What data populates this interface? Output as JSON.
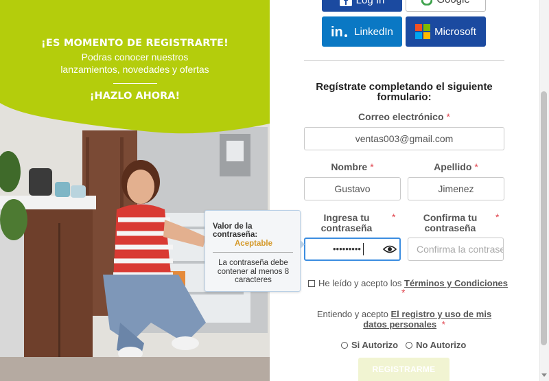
{
  "hero": {
    "headline": "¡ES MOMENTO DE REGISTRARTE!",
    "subtitle_line1": "Podras conocer nuestros",
    "subtitle_line2": "lanzamientos, novedades y ofertas",
    "cta": "¡HAZLO AHORA!"
  },
  "social": {
    "top_left_label": "Log In",
    "top_right_label": "Google",
    "linkedin_label": "LinkedIn",
    "microsoft_label": "Microsoft"
  },
  "form": {
    "title": "Regístrate completando el siguiente formulario:",
    "email_label": "Correo electrónico",
    "email_value": "ventas003@gmail.com",
    "name_label": "Nombre",
    "name_value": "Gustavo",
    "lastname_label": "Apellido",
    "lastname_value": "Jimenez",
    "password_label_line1": "Ingresa tu",
    "password_label_line2": "contraseña",
    "password_masked": "•••••••••",
    "confirm_label_line1": "Confirma tu",
    "confirm_label_line2": "contraseña",
    "confirm_placeholder": "Confirma la contraseña",
    "required_mark": "*",
    "terms_prefix": "He leído y acepto los",
    "terms_link": "Términos y Condiciones",
    "consent_prefix": "Entiendo y acepto",
    "consent_link": "El registro y uso de mis datos personales",
    "radio_yes": "Si Autorizo",
    "radio_no": "No Autorizo",
    "submit_label": "REGISTRARME"
  },
  "tooltip": {
    "title": "Valor de la contraseña:",
    "level": "Aceptable",
    "message": "La contraseña debe contener al menos 8 caracteres"
  },
  "colors": {
    "hero_green": "#b4cd0c",
    "linkedin_blue": "#0a78c4",
    "microsoft_blue": "#1b4aa0",
    "required_red": "#e0404a",
    "focus_blue": "#3b8de0",
    "strength_orange": "#d59a2b",
    "submit_disabled": "#f1f4d2"
  }
}
